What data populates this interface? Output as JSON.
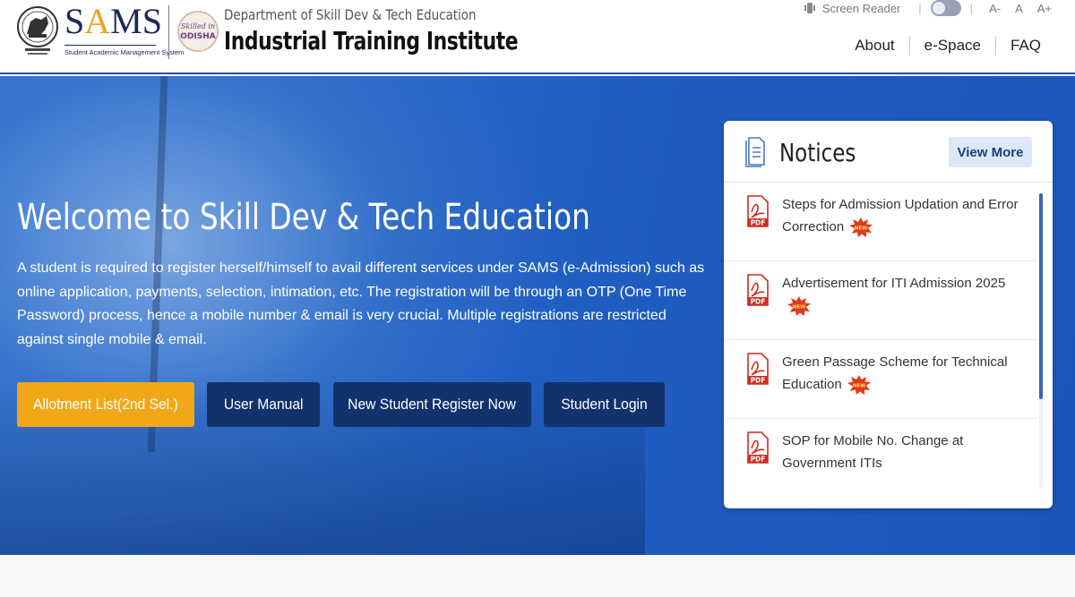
{
  "header": {
    "sams": {
      "logo_text": "SAMS",
      "subtitle": "Student Academic Management System"
    },
    "skilled_logo_text": "Skilled in ODISHA",
    "department": "Department of Skill Dev & Tech Education",
    "institute": "Industrial Training Institute",
    "accessibility": {
      "screen_reader_label": "Screen Reader",
      "font_decrease": "A-",
      "font_normal": "A",
      "font_increase": "A+"
    },
    "nav": [
      "About",
      "e-Space",
      "FAQ"
    ]
  },
  "hero": {
    "title": "Welcome to Skill Dev & Tech Education",
    "description": "A student is required to register herself/himself to avail different services under SAMS (e-Admission) such as online application, payments, selection, intimation, etc. The registration will be through an OTP (One Time Password) process, hence a mobile number & email is very crucial. Multiple registrations are restricted against single mobile & email.",
    "buttons": {
      "allotment": "Allotment List(2nd Sel.)",
      "manual": "User Manual",
      "register": "New Student Register Now",
      "login": "Student Login"
    }
  },
  "notices": {
    "title": "Notices",
    "view_more": "View More",
    "items": [
      {
        "text": "Steps for Admission Updation and Error Correction",
        "is_new": true
      },
      {
        "text": "Advertisement for ITI Admission 2025",
        "is_new": true
      },
      {
        "text": "Green Passage Scheme for Technical Education",
        "is_new": true
      },
      {
        "text": "SOP for Mobile No. Change at Government ITIs",
        "is_new": false
      }
    ]
  },
  "colors": {
    "hero_blue": "#2566c7",
    "allotment_yellow": "#f0a818",
    "dark_button": "#12326e",
    "view_more_bg": "#dde8f6",
    "pdf_red": "#d42a20"
  },
  "icons": [
    "odisha-emblem-icon",
    "skilled-in-odisha-logo",
    "screen-reader-icon",
    "document-icon",
    "pdf-icon",
    "new-badge-icon"
  ]
}
